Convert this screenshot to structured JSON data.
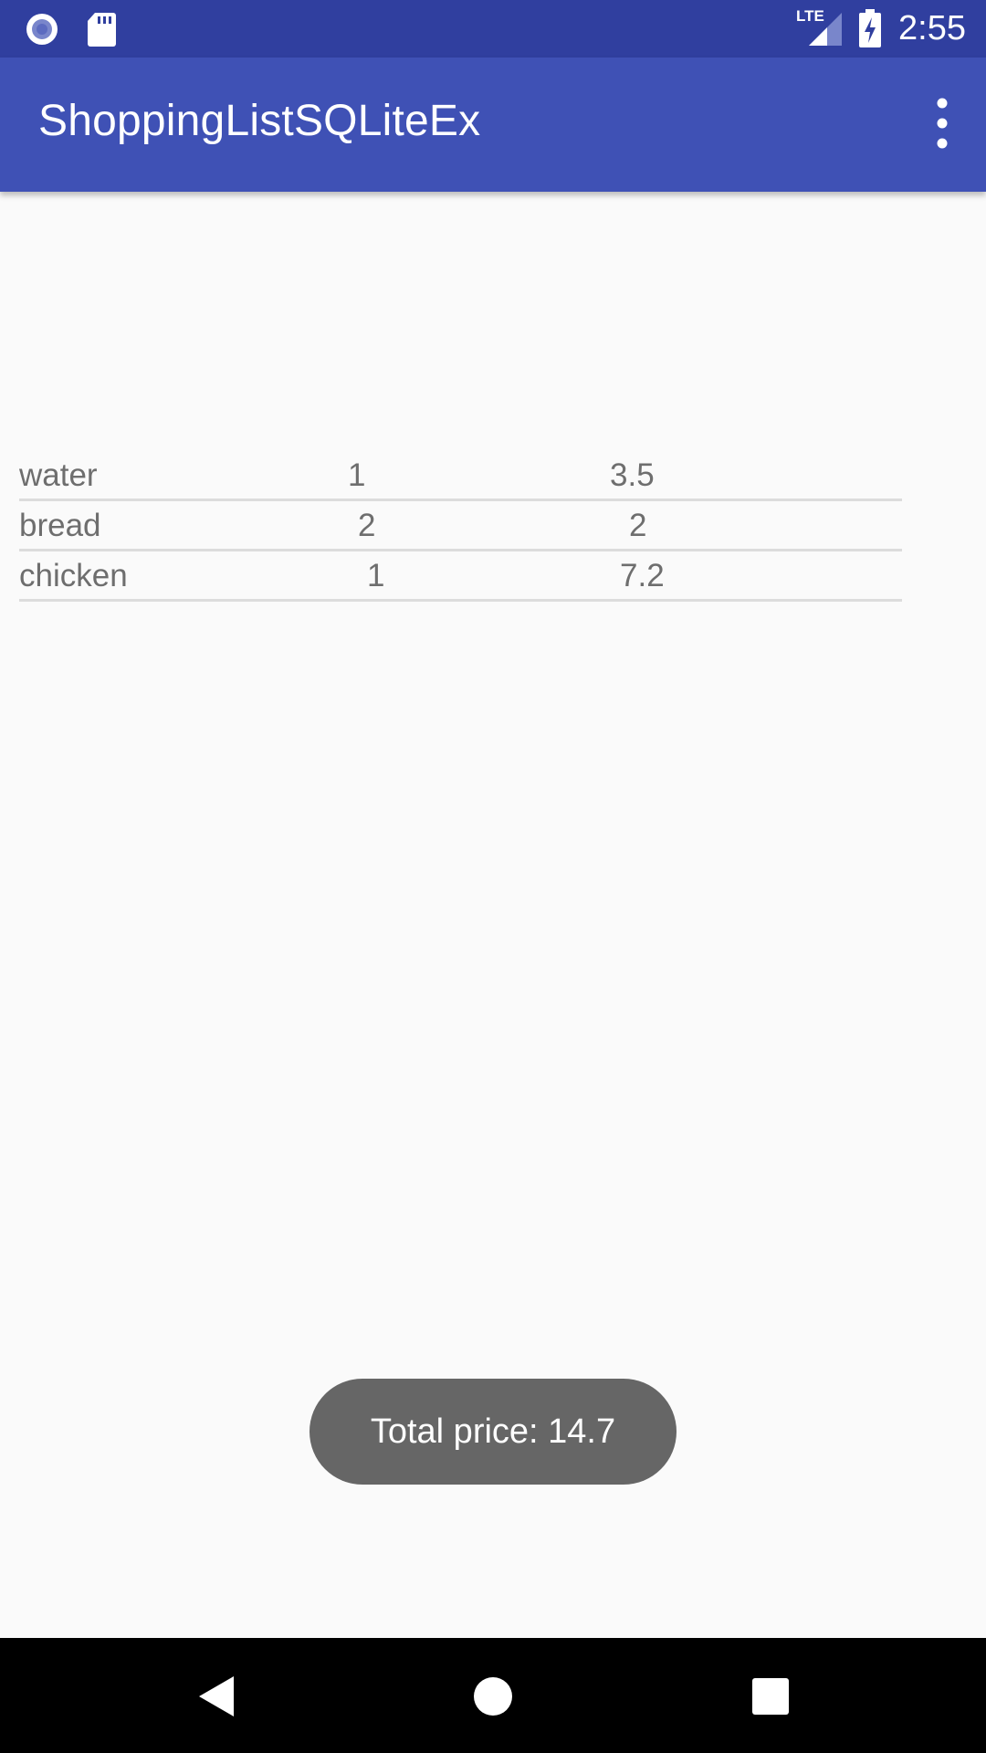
{
  "status_bar": {
    "time": "2:55",
    "network_label": "LTE",
    "icons": [
      "record-icon",
      "sd-card-icon",
      "lte-signal-icon",
      "battery-charging-icon"
    ]
  },
  "app_bar": {
    "title": "ShoppingListSQLiteEx",
    "menu_icon": "overflow-menu-icon"
  },
  "items": [
    {
      "name": "water",
      "quantity": "1",
      "price": "3.5"
    },
    {
      "name": "bread",
      "quantity": "2",
      "price": "2"
    },
    {
      "name": "chicken",
      "quantity": "1",
      "price": "7.2"
    }
  ],
  "toast": {
    "text": "Total price: 14.7"
  },
  "nav_bar": {
    "icons": [
      "back-icon",
      "home-icon",
      "recents-icon"
    ]
  },
  "colors": {
    "primary": "#3f51b5",
    "primary_dark": "#303f9f",
    "background": "#fafafa",
    "toast_bg": "#666666"
  }
}
